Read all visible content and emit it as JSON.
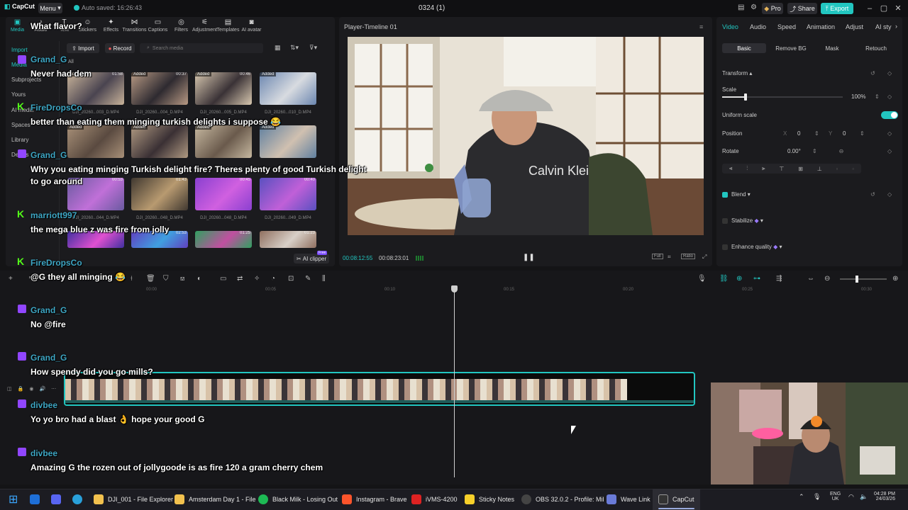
{
  "titlebar": {
    "app_name": "CapCut",
    "menu_label": "Menu",
    "autosave": "Auto saved: 16:26:43",
    "project_title": "0324 (1)",
    "pro_label": "Pro",
    "share_label": "Share",
    "export_label": "Export",
    "accent": "#22c6c0"
  },
  "media_toolbar": [
    {
      "label": "Media",
      "icon": "media-icon"
    },
    {
      "label": "Audio",
      "icon": "audio-icon"
    },
    {
      "label": "Text",
      "icon": "text-icon"
    },
    {
      "label": "Stickers",
      "icon": "stickers-icon"
    },
    {
      "label": "Effects",
      "icon": "effects-icon"
    },
    {
      "label": "Transitions",
      "icon": "transitions-icon"
    },
    {
      "label": "Captions",
      "icon": "captions-icon"
    },
    {
      "label": "Filters",
      "icon": "filters-icon"
    },
    {
      "label": "Adjustment",
      "icon": "adjustment-icon"
    },
    {
      "label": "Templates",
      "icon": "templates-icon"
    },
    {
      "label": "AI avatar",
      "icon": "ai-avatar-icon"
    }
  ],
  "media_sidebar": [
    "Import",
    "Media",
    "Subprojects",
    "Yours",
    "AI media",
    "Spaces",
    "Library",
    "Details"
  ],
  "media_controls": {
    "import_label": "Import",
    "record_label": "Record",
    "search_placeholder": "Search media",
    "all_label": "All",
    "ai_clipper_label": "AI clipper",
    "free_badge": "Free"
  },
  "media_items": [
    {
      "name": "DJI_20260...003_D.MP4",
      "added": "Added",
      "duration": "01:58"
    },
    {
      "name": "DJI_20260...004_D.MP4",
      "added": "Added",
      "duration": "00:37"
    },
    {
      "name": "DJI_20260...005_D.MP4",
      "added": "Added",
      "duration": "00:46"
    },
    {
      "name": "DJI_20260...010_D.MP4",
      "added": "Added",
      "duration": ""
    },
    {
      "name": "",
      "added": "Added",
      "duration": ""
    },
    {
      "name": "",
      "added": "Added",
      "duration": ""
    },
    {
      "name": "",
      "added": "Added",
      "duration": ""
    },
    {
      "name": "",
      "added": "Added",
      "duration": ""
    },
    {
      "name": "DJI_20260...044_D.MP4",
      "added": "",
      "duration": "00:53"
    },
    {
      "name": "DJI_20260...048_D.MP4",
      "added": "",
      "duration": "01:43"
    },
    {
      "name": "DJI_20260...048_D.MP4",
      "added": "",
      "duration": "00:45"
    },
    {
      "name": "DJI_20260...049_D.MP4",
      "added": "",
      "duration": "00:40"
    },
    {
      "name": "",
      "added": "",
      "duration": ""
    },
    {
      "name": "",
      "added": "",
      "duration": "02:53"
    },
    {
      "name": "",
      "added": "",
      "duration": "01:25"
    },
    {
      "name": "",
      "added": "",
      "duration": "01:23"
    }
  ],
  "player": {
    "title": "Player-Timeline 01",
    "current_time": "00:08:12:55",
    "total_time": "00:08:23:01",
    "full_label": "Full",
    "ratio_label": "Ratio"
  },
  "props": {
    "tabs": [
      "Video",
      "Audio",
      "Speed",
      "Animation",
      "Adjust",
      "AI sty"
    ],
    "subtabs": [
      "Basic",
      "Remove BG",
      "Mask",
      "Retouch"
    ],
    "transform_label": "Transform",
    "scale_label": "Scale",
    "scale_value": "100%",
    "scale_fraction": 0.12,
    "uniform_scale_label": "Uniform scale",
    "position_label": "Position",
    "pos_x_label": "X",
    "pos_x": "0",
    "pos_y_label": "Y",
    "pos_y": "0",
    "rotate_label": "Rotate",
    "rotate_value": "0.00°",
    "blend_label": "Blend",
    "stabilize_label": "Stabilize",
    "enhance_label": "Enhance quality"
  },
  "timeline": {
    "ruler": [
      "00:00",
      "00:05",
      "00:10",
      "00:15",
      "00:20",
      "00:25",
      "00:30"
    ]
  },
  "chat": [
    {
      "platform": "twitch",
      "user": "Grand_G",
      "message": "What flavor?"
    },
    {
      "platform": "twitch",
      "user": "Grand_G",
      "message": "Never had dem"
    },
    {
      "platform": "kick",
      "user": "FireDropsCo",
      "message": "better than eating them minging turkish delights i suppose 😂"
    },
    {
      "platform": "twitch",
      "user": "Grand_G",
      "message": "Why you eating minging Turkish delight fire? Theres plenty of good Turkish delight"
    },
    {
      "platform": "",
      "user": "",
      "message": "to go around"
    },
    {
      "platform": "kick",
      "user": "marriott997",
      "message": "the mega blue z was fire from jolly"
    },
    {
      "platform": "kick",
      "user": "FireDropsCo",
      "message": "@G they all minging 😂"
    },
    {
      "platform": "twitch",
      "user": "Grand_G",
      "message": "No @fire"
    },
    {
      "platform": "twitch",
      "user": "Grand_G",
      "message": "How spendy did you go mills?"
    },
    {
      "platform": "twitch",
      "user": "divbee",
      "message": "Yo yo bro had a blast 👌 hope your good G"
    },
    {
      "platform": "twitch",
      "user": "divbee",
      "message": "Amazing G the rozen out of jollygoode is as fire 120 a gram cherry chem"
    }
  ],
  "taskbar": {
    "items": [
      {
        "label": "DJI_001 - File Explorer",
        "color": "#f2c14e"
      },
      {
        "label": "Amsterdam Day 1 - File",
        "color": "#f2c14e"
      },
      {
        "label": "Black Milk - Losing Out",
        "color": "#1db954"
      },
      {
        "label": "Instagram - Brave",
        "color": "#fb542b"
      },
      {
        "label": "iVMS-4200",
        "color": "#d22"
      },
      {
        "label": "Sticky Notes",
        "color": "#f7d02a"
      },
      {
        "label": "OBS 32.0.2 - Profile: Mil",
        "color": "#444"
      },
      {
        "label": "Wave Link",
        "color": "#6a7bd8"
      },
      {
        "label": "CapCut",
        "color": "#333"
      }
    ],
    "lang": "ENG",
    "region": "UK",
    "time": "04:28 PM",
    "date": "24/03/26"
  }
}
